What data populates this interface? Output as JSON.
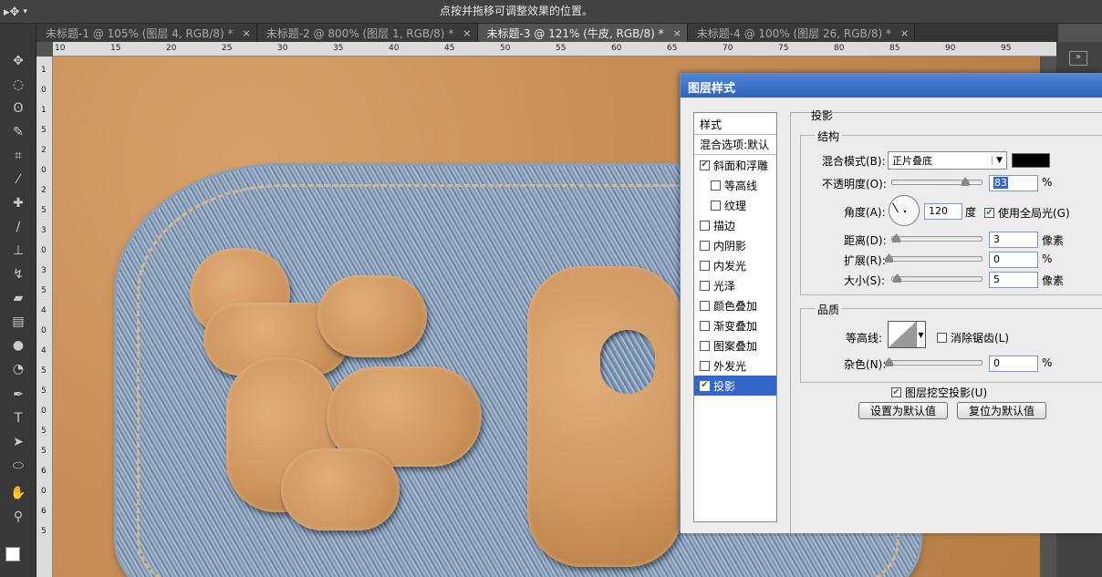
{
  "options_bar": {
    "tool_icon": "move-tool-icon",
    "hint": "点按并拖移可调整效果的位置。"
  },
  "tabs": [
    {
      "label": "未标题-1 @ 105% (图层 4, RGB/8) *",
      "close": "×"
    },
    {
      "label": "未标题-2 @ 800% (图层 1, RGB/8) *",
      "close": "×"
    },
    {
      "label": "未标题-3 @ 121% (牛皮, RGB/8) *",
      "close": "×"
    },
    {
      "label": "未标题-4 @ 100% (图层 26, RGB/8) *",
      "close": "×"
    }
  ],
  "ruler_top": [
    "10",
    "15",
    "20",
    "25",
    "30",
    "35",
    "40",
    "45",
    "50",
    "55",
    "60",
    "65",
    "70",
    "75",
    "80",
    "85",
    "90",
    "95"
  ],
  "ruler_left": [
    "1",
    "0",
    "1",
    "5",
    "2",
    "0",
    "2",
    "5",
    "3",
    "0",
    "3",
    "5",
    "4",
    "0",
    "4",
    "5",
    "5",
    "0",
    "5",
    "5",
    "6",
    "0",
    "6",
    "5"
  ],
  "dialog": {
    "title": "图层样式",
    "styles": [
      {
        "label": "样式",
        "checkbox": false,
        "checked": false
      },
      {
        "label": "混合选项:默认",
        "checkbox": false,
        "checked": false
      },
      {
        "label": "斜面和浮雕",
        "checkbox": true,
        "checked": true
      },
      {
        "label": "等高线",
        "checkbox": true,
        "checked": false,
        "indent": true
      },
      {
        "label": "纹理",
        "checkbox": true,
        "checked": false,
        "indent": true
      },
      {
        "label": "描边",
        "checkbox": true,
        "checked": false
      },
      {
        "label": "内阴影",
        "checkbox": true,
        "checked": false
      },
      {
        "label": "内发光",
        "checkbox": true,
        "checked": false
      },
      {
        "label": "光泽",
        "checkbox": true,
        "checked": false
      },
      {
        "label": "颜色叠加",
        "checkbox": true,
        "checked": false
      },
      {
        "label": "渐变叠加",
        "checkbox": true,
        "checked": false
      },
      {
        "label": "图案叠加",
        "checkbox": true,
        "checked": false
      },
      {
        "label": "外发光",
        "checkbox": true,
        "checked": false
      },
      {
        "label": "投影",
        "checkbox": true,
        "checked": true,
        "selected": true
      }
    ],
    "section": "投影",
    "structure": {
      "group": "结构",
      "blend_mode_label": "混合模式(B):",
      "blend_mode_value": "正片叠底",
      "shadow_color": "#000000",
      "opacity_label": "不透明度(O):",
      "opacity_value": "83",
      "opacity_unit": "%",
      "angle_label": "角度(A):",
      "angle_value": "120",
      "angle_unit": "度",
      "global_light_label": "使用全局光(G)",
      "global_light_checked": true,
      "distance_label": "距离(D):",
      "distance_value": "3",
      "distance_unit": "像素",
      "spread_label": "扩展(R):",
      "spread_value": "0",
      "spread_unit": "%",
      "size_label": "大小(S):",
      "size_value": "5",
      "size_unit": "像素"
    },
    "quality": {
      "group": "品质",
      "contour_label": "等高线:",
      "antialias_label": "消除锯齿(L)",
      "antialias_checked": false,
      "noise_label": "杂色(N):",
      "noise_value": "0",
      "noise_unit": "%"
    },
    "knockout_label": "图层挖空投影(U)",
    "knockout_checked": true,
    "make_default": "设置为默认值",
    "reset_default": "复位为默认值"
  }
}
